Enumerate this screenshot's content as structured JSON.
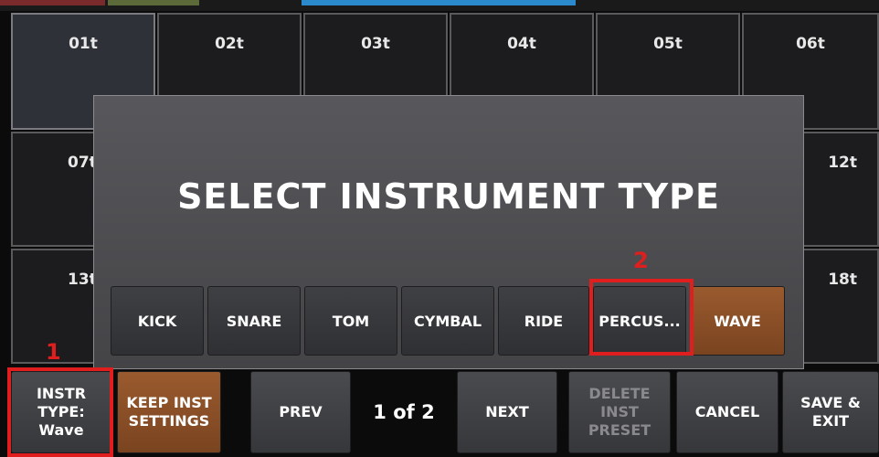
{
  "pads": {
    "row1": [
      "01t",
      "02t",
      "03t",
      "04t",
      "05t",
      "06t"
    ],
    "row2_left": "07t",
    "row2_right": "12t",
    "row3_left": "13t",
    "row3_right": "18t"
  },
  "dialog": {
    "title": "SELECT INSTRUMENT TYPE",
    "types": [
      "KICK",
      "SNARE",
      "TOM",
      "CYMBAL",
      "RIDE",
      "PERCUS...",
      "WAVE"
    ],
    "selected": "WAVE"
  },
  "bottom": {
    "instr_type": "INSTR\nTYPE:\nWave",
    "keep_inst": "KEEP INST\nSETTINGS",
    "prev": "PREV",
    "page": "1 of 2",
    "next": "NEXT",
    "delete_preset": "DELETE\nINST\nPRESET",
    "cancel": "CANCEL",
    "save_exit": "SAVE &\nEXIT"
  },
  "annotations": {
    "marker1": "1",
    "marker2": "2",
    "color": "#e01e1e"
  },
  "colors": {
    "accent_orange": "#8a4f27",
    "dialog_bg": "#4e4e52"
  }
}
